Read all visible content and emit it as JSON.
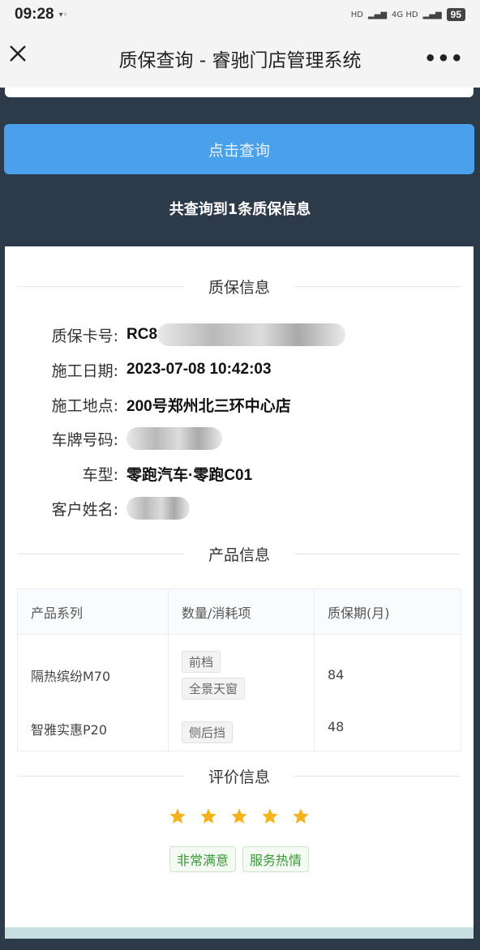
{
  "status_bar": {
    "time": "09:28",
    "notification_icon": "signal-muted-icon",
    "network_left": "HD",
    "network_right": "4G HD",
    "battery": "95"
  },
  "nav": {
    "title": "质保查询 - 睿驰门店管理系统",
    "more": "•••"
  },
  "query_button_label": "点击查询",
  "result_count": "共查询到1条质保信息",
  "warranty_section": {
    "title": "质保信息",
    "fields": [
      {
        "label": "质保卡号:",
        "value": "RC8"
      },
      {
        "label": "施工日期:",
        "value": "2023-07-08 10:42:03"
      },
      {
        "label": "施工地点:",
        "value": "200号郑州北三环中心店"
      },
      {
        "label": "车牌号码:",
        "value": ""
      },
      {
        "label": "车型:",
        "value": "零跑汽车·零跑C01"
      },
      {
        "label": "客户姓名:",
        "value": ""
      }
    ]
  },
  "product_section": {
    "title": "产品信息",
    "headers": [
      "产品系列",
      "数量/消耗项",
      "质保期(月)"
    ],
    "rows": [
      {
        "series": "隔热缤纷M70",
        "items": [
          "前档",
          "全景天窗"
        ],
        "period": "84"
      },
      {
        "series": "智雅实惠P20",
        "items": [
          "侧后挡"
        ],
        "period": "48"
      }
    ]
  },
  "evaluation_section": {
    "title": "评价信息",
    "stars": 5,
    "star_color": "#f5b21b",
    "tags": [
      "非常满意",
      "服务热情"
    ]
  },
  "colors": {
    "accent_button": "#4aa0ea",
    "page_background": "#2d3a4a",
    "tag_green": "#3a9a3a"
  }
}
